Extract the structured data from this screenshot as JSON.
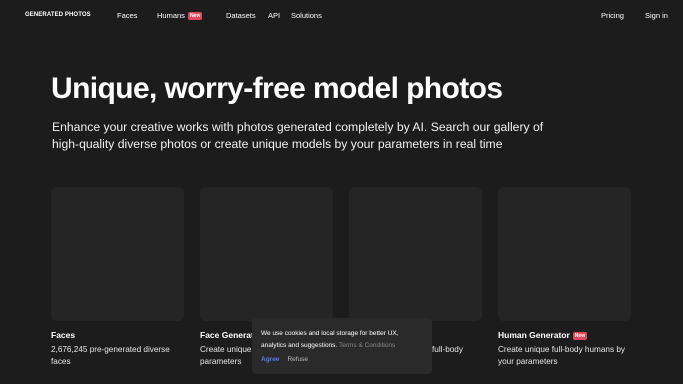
{
  "nav": {
    "logo": "GENERATED PHOTOS",
    "links": [
      {
        "label": "Faces"
      },
      {
        "label": "Humans",
        "badge": "New"
      },
      {
        "label": "Datasets"
      },
      {
        "label": "API"
      },
      {
        "label": "Solutions"
      }
    ],
    "pricing": "Pricing",
    "signin": "Sign in"
  },
  "hero": {
    "title": "Unique, worry-free model photos",
    "subtitle_line1": "Enhance your creative works with photos generated completely by AI. Search our gallery of",
    "subtitle_line2": "high-quality diverse photos or create unique models by your parameters in real time"
  },
  "cards": [
    {
      "title": "Faces",
      "desc_line1": "2,676,245 pre-generated diverse",
      "desc_line2": "faces"
    },
    {
      "title": "Face Generat",
      "desc_line1": "Create unique",
      "desc_line2": "parameters"
    },
    {
      "title": "",
      "desc_line1": "full-body",
      "desc_line2": ""
    },
    {
      "title": "Human Generator",
      "badge": "New",
      "desc_line1": "Create unique full-body humans by",
      "desc_line2": "your parameters"
    }
  ],
  "cookie": {
    "line1": "We use cookies and local storage for better UX,",
    "line2": "analytics and suggestions.",
    "link": "Terms & Conditions",
    "agree": "Agree",
    "refuse": "Refuse"
  },
  "colors": {
    "background": "#1d1c1c",
    "card": "#262525",
    "badge": "#e2475e",
    "agree": "#5a7cf0"
  }
}
